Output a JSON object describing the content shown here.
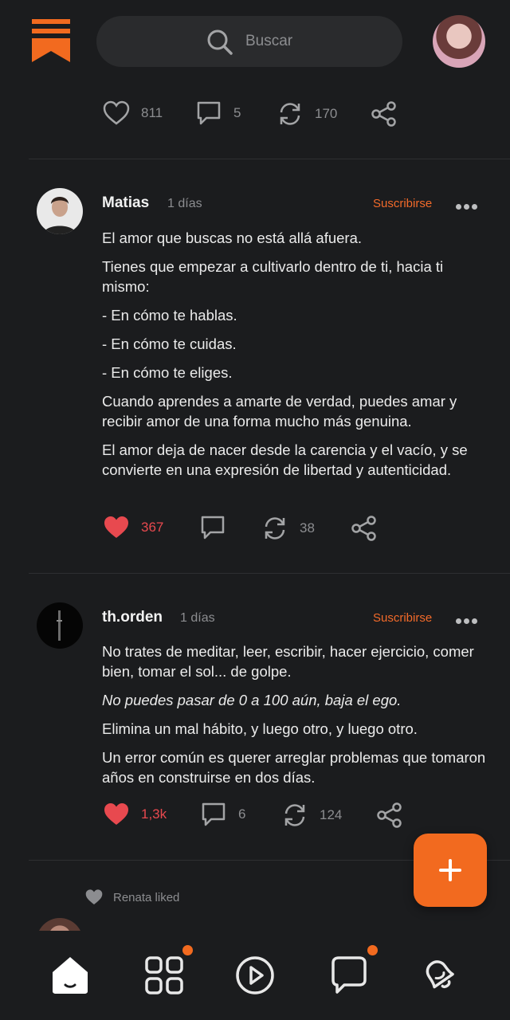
{
  "header": {
    "search_placeholder": "Buscar",
    "icons": {
      "logo": "bookmark-logo-icon",
      "search": "search-icon",
      "avatar": "user-avatar"
    }
  },
  "top_actions": {
    "likes": "811",
    "comments": "5",
    "reposts": "170"
  },
  "posts": [
    {
      "user": "Matias",
      "time": "1 días",
      "subscribe": "Suscribirse",
      "paragraphs": [
        "El amor que buscas no está allá afuera.",
        "Tienes que empezar a cultivarlo dentro de ti, hacia ti mismo:",
        "- En cómo te hablas.",
        "- En cómo te cuidas.",
        "- En cómo te eliges.",
        "Cuando aprendes a amarte de verdad, puedes amar y recibir amor de una forma mucho más genuina.",
        "El amor deja de nacer desde la carencia y el vacío, y se convierte en una expresión de libertad y autenticidad."
      ],
      "likes": "367",
      "reposts": "38"
    },
    {
      "user": "th.orden",
      "time": "1 días",
      "subscribe": "Suscribirse",
      "paragraphs": [
        "No trates de meditar, leer, escribir, hacer ejercicio, comer bien, tomar el sol... de golpe.",
        "No puedes pasar de 0 a 100 aún, baja el ego.",
        "Elimina un mal hábito, y luego otro, y luego otro.",
        "Un error común es querer arreglar problemas que tomaron años en construirse en dos días."
      ],
      "likes": "1,3k",
      "comments": "6",
      "reposts": "124"
    }
  ],
  "liked_notice": "Renata liked",
  "colors": {
    "accent": "#f26a1f",
    "like_red": "#e8494f",
    "background": "#1b1c1e"
  },
  "bottom_nav": [
    "home-icon",
    "grid-icon",
    "play-icon",
    "chat-icon",
    "bell-icon"
  ]
}
